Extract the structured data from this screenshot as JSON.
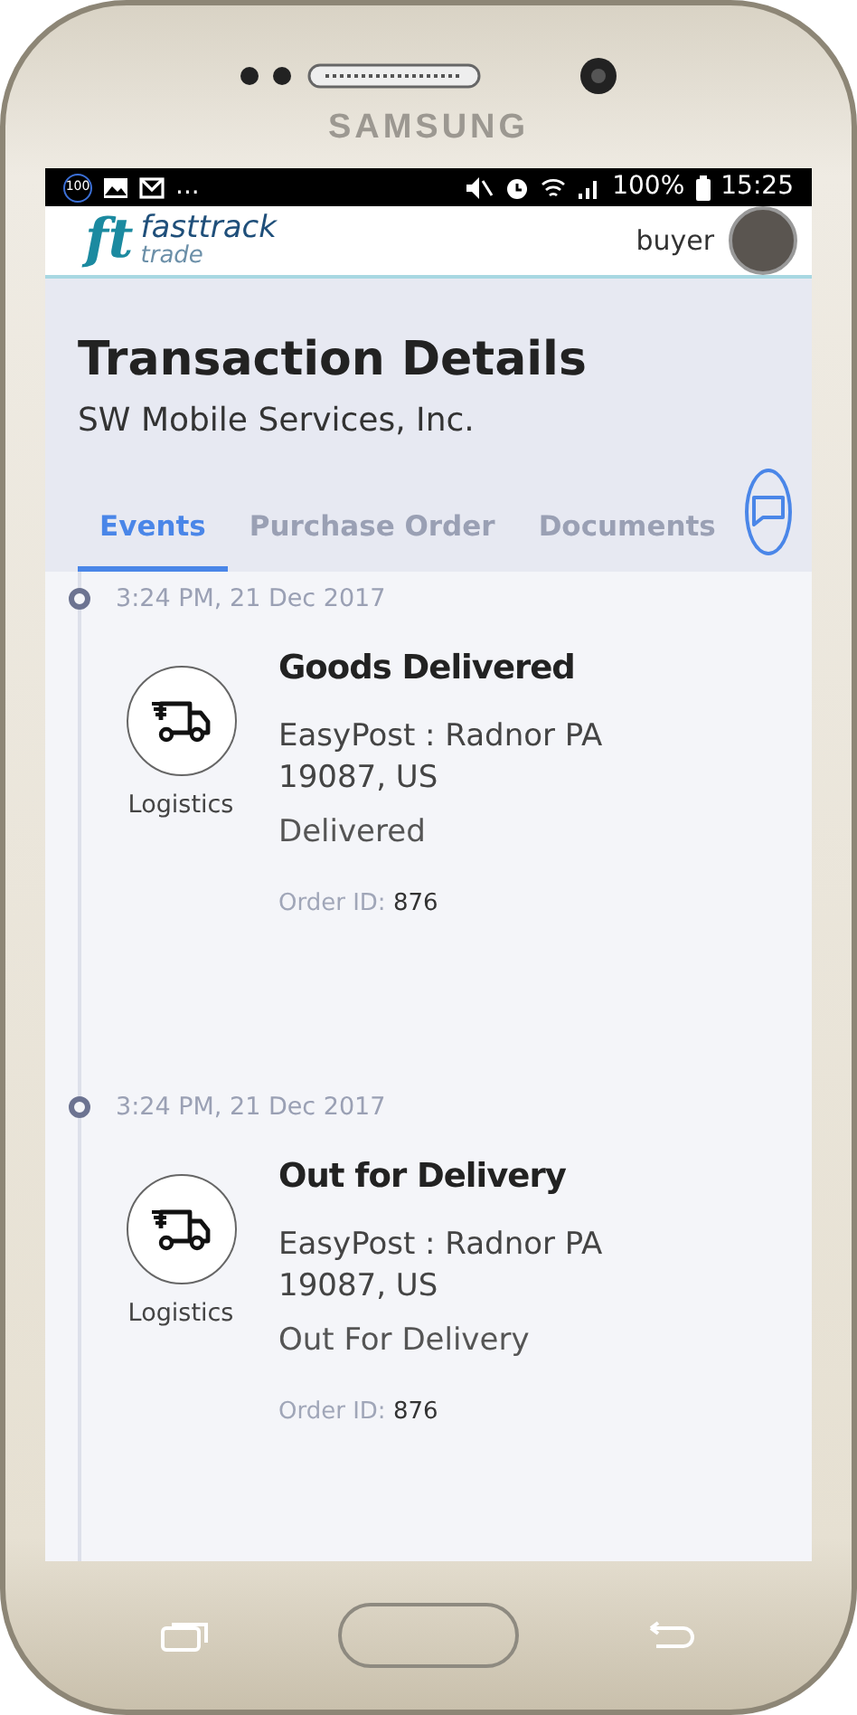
{
  "device": {
    "brand": "SAMSUNG"
  },
  "status_bar": {
    "badge": "100",
    "more": "...",
    "battery": "100%",
    "time": "15:25"
  },
  "header": {
    "logo_mark": "ft",
    "logo_name": "fasttrack",
    "logo_sub": "trade",
    "user": "buyer"
  },
  "page": {
    "title": "Transaction Details",
    "subtitle": "SW Mobile Services, Inc."
  },
  "tabs": [
    {
      "label": "Events",
      "selected": true
    },
    {
      "label": "Purchase Order",
      "selected": false
    },
    {
      "label": "Documents",
      "selected": false
    }
  ],
  "events": [
    {
      "time": "3:24 PM, 21 Dec 2017",
      "category": "Logistics",
      "title": "Goods Delivered",
      "location": "EasyPost : Radnor PA 19087, US",
      "status": "Delivered",
      "order_label": "Order ID:",
      "order_id": "876"
    },
    {
      "time": "3:24 PM, 21 Dec 2017",
      "category": "Logistics",
      "title": "Out for Delivery",
      "location": "EasyPost : Radnor PA 19087, US",
      "status": "Out For Delivery",
      "order_label": "Order ID:",
      "order_id": "876"
    }
  ]
}
